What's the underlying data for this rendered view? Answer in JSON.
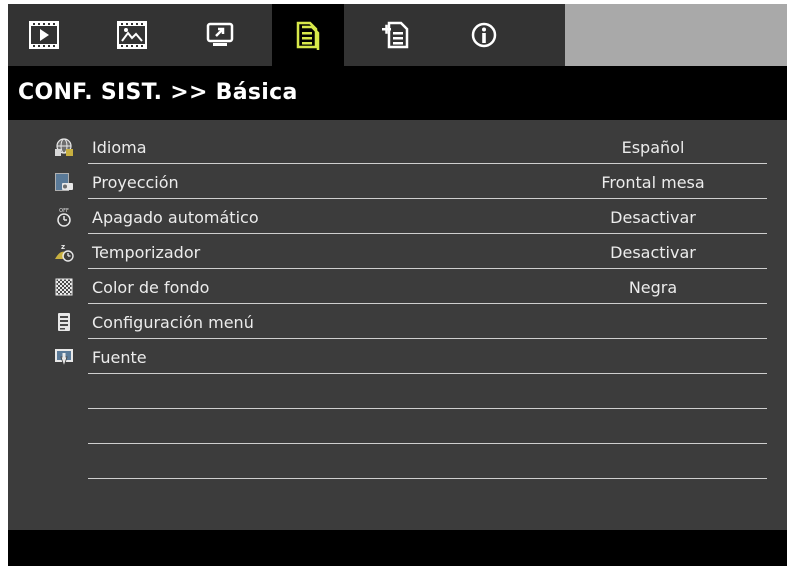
{
  "tabs": [
    {
      "icon": "film-play-icon"
    },
    {
      "icon": "image-picture-icon"
    },
    {
      "icon": "screen-display-icon"
    },
    {
      "icon": "document-setup-icon",
      "active": true
    },
    {
      "icon": "document-add-icon"
    },
    {
      "icon": "info-icon"
    }
  ],
  "title": "CONF. SIST. >> Básica",
  "items": [
    {
      "icon": "globe-language-icon",
      "label": "Idioma",
      "value": "Español"
    },
    {
      "icon": "projector-icon",
      "label": "Proyección",
      "value": "Frontal mesa"
    },
    {
      "icon": "power-off-timer-icon",
      "label": "Apagado automático",
      "value": "Desactivar"
    },
    {
      "icon": "sleep-timer-icon",
      "label": "Temporizador",
      "value": "Desactivar"
    },
    {
      "icon": "checker-pattern-icon",
      "label": "Color de fondo",
      "value": "Negra"
    },
    {
      "icon": "menu-config-icon",
      "label": "Configuración menú",
      "value": ""
    },
    {
      "icon": "source-input-icon",
      "label": "Fuente",
      "value": ""
    }
  ],
  "colors": {
    "panel": "#3c3c3c",
    "tabbar": "#333333",
    "active_tab": "#000000",
    "tab_icon": "#ffffff",
    "active_tab_icon": "#d8e84a",
    "empty_tab_area": "#a9a9a9",
    "text": "#ececec",
    "divider": "#cfcfcf"
  }
}
